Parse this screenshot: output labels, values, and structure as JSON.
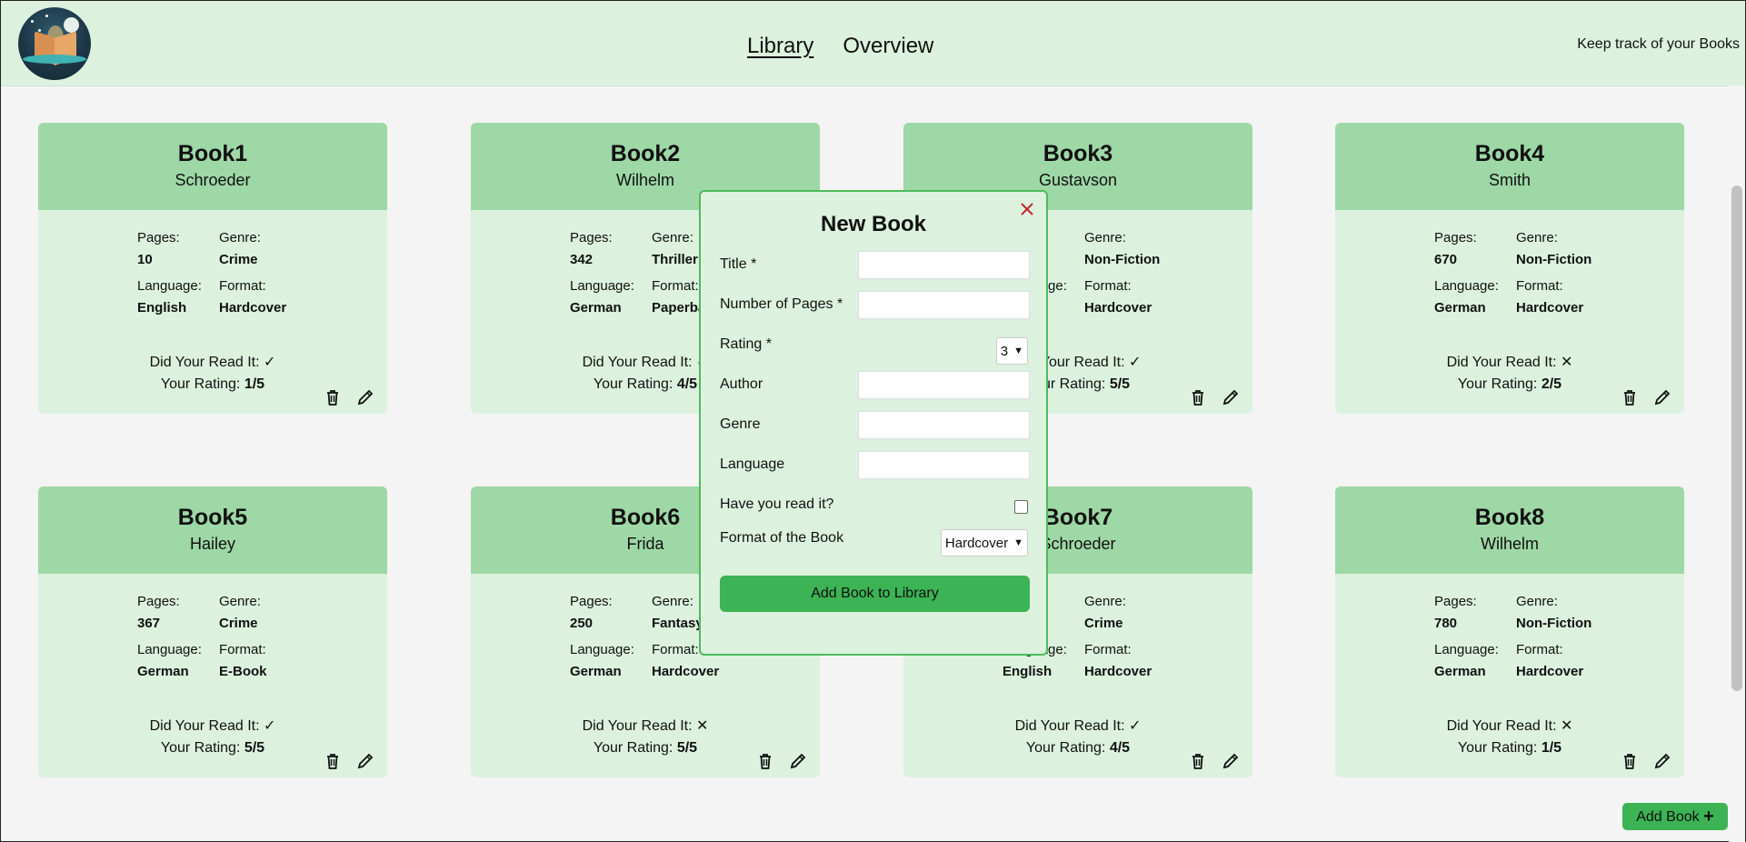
{
  "header": {
    "nav": [
      {
        "label": "Library",
        "active": true
      },
      {
        "label": "Overview",
        "active": false
      }
    ],
    "tagline": "Keep track of your Books"
  },
  "labels": {
    "pages": "Pages:",
    "genre": "Genre:",
    "language": "Language:",
    "format": "Format:",
    "read": "Did Your Read It:",
    "rating": "Your Rating:"
  },
  "books": [
    {
      "title": "Book1",
      "author": "Schroeder",
      "pages": "10",
      "genre": "Crime",
      "language": "English",
      "format": "Hardcover",
      "read": "✓",
      "rating": "1/5"
    },
    {
      "title": "Book2",
      "author": "Wilhelm",
      "pages": "342",
      "genre": "Thriller",
      "language": "German",
      "format": "Paperback",
      "read": "✓",
      "rating": "4/5"
    },
    {
      "title": "Book3",
      "author": "Gustavson",
      "pages": "",
      "genre": "Non-Fiction",
      "language": "",
      "format": "Hardcover",
      "read": "✓",
      "rating": "5/5"
    },
    {
      "title": "Book4",
      "author": "Smith",
      "pages": "670",
      "genre": "Non-Fiction",
      "language": "German",
      "format": "Hardcover",
      "read": "✕",
      "rating": "2/5"
    },
    {
      "title": "Book5",
      "author": "Hailey",
      "pages": "367",
      "genre": "Crime",
      "language": "German",
      "format": "E-Book",
      "read": "✓",
      "rating": "5/5"
    },
    {
      "title": "Book6",
      "author": "Frida",
      "pages": "250",
      "genre": "Fantasy",
      "language": "German",
      "format": "Hardcover",
      "read": "✕",
      "rating": "5/5"
    },
    {
      "title": "Book7",
      "author": "Schroeder",
      "pages": "",
      "genre": "Crime",
      "language": "English",
      "format": "Hardcover",
      "read": "✓",
      "rating": "4/5"
    },
    {
      "title": "Book8",
      "author": "Wilhelm",
      "pages": "780",
      "genre": "Non-Fiction",
      "language": "German",
      "format": "Hardcover",
      "read": "✕",
      "rating": "1/5"
    }
  ],
  "modal": {
    "title": "New Book",
    "fields": {
      "title": "Title *",
      "pages": "Number of Pages *",
      "rating": "Rating *",
      "author": "Author",
      "genre": "Genre",
      "language": "Language",
      "read": "Have you read it?",
      "format": "Format of the Book"
    },
    "rating_value": "3",
    "format_value": "Hardcover",
    "submit": "Add Book to Library"
  },
  "add_book": "Add Book"
}
